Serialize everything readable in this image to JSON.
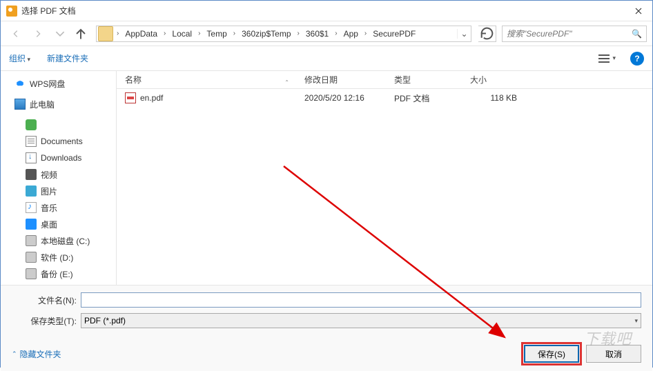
{
  "window": {
    "title": "选择 PDF 文档"
  },
  "breadcrumb": {
    "segs": [
      "AppData",
      "Local",
      "Temp",
      "360zip$Temp",
      "360$1",
      "App",
      "SecurePDF"
    ]
  },
  "search": {
    "placeholder": "搜索\"SecurePDF\""
  },
  "toolbar": {
    "organize": "组织",
    "newfolder": "新建文件夹"
  },
  "columns": {
    "name": "名称",
    "date": "修改日期",
    "type": "类型",
    "size": "大小"
  },
  "sidebar": {
    "items": [
      {
        "label": "WPS网盘",
        "icon": "ic-cloud",
        "sub": false
      },
      {
        "label": "此电脑",
        "icon": "ic-pc",
        "sub": false
      },
      {
        "label": "",
        "icon": "ic-app",
        "sub": true
      },
      {
        "label": "Documents",
        "icon": "ic-doc",
        "sub": true
      },
      {
        "label": "Downloads",
        "icon": "ic-dl",
        "sub": true
      },
      {
        "label": "视频",
        "icon": "ic-vid",
        "sub": true
      },
      {
        "label": "图片",
        "icon": "ic-pic",
        "sub": true
      },
      {
        "label": "音乐",
        "icon": "ic-mus",
        "sub": true
      },
      {
        "label": "桌面",
        "icon": "ic-desk",
        "sub": true
      },
      {
        "label": "本地磁盘 (C:)",
        "icon": "ic-disk",
        "sub": true
      },
      {
        "label": "软件 (D:)",
        "icon": "ic-disk",
        "sub": true
      },
      {
        "label": "备份 (E:)",
        "icon": "ic-disk",
        "sub": true
      }
    ]
  },
  "files": [
    {
      "name": "en.pdf",
      "date": "2020/5/20 12:16",
      "type": "PDF 文档",
      "size": "118 KB"
    }
  ],
  "form": {
    "filename_label": "文件名(N):",
    "filename_value": "",
    "filetype_label": "保存类型(T):",
    "filetype_value": "PDF (*.pdf)"
  },
  "actions": {
    "hide_folders": "隐藏文件夹",
    "save": "保存(S)",
    "cancel": "取消"
  },
  "watermark": "下载吧"
}
